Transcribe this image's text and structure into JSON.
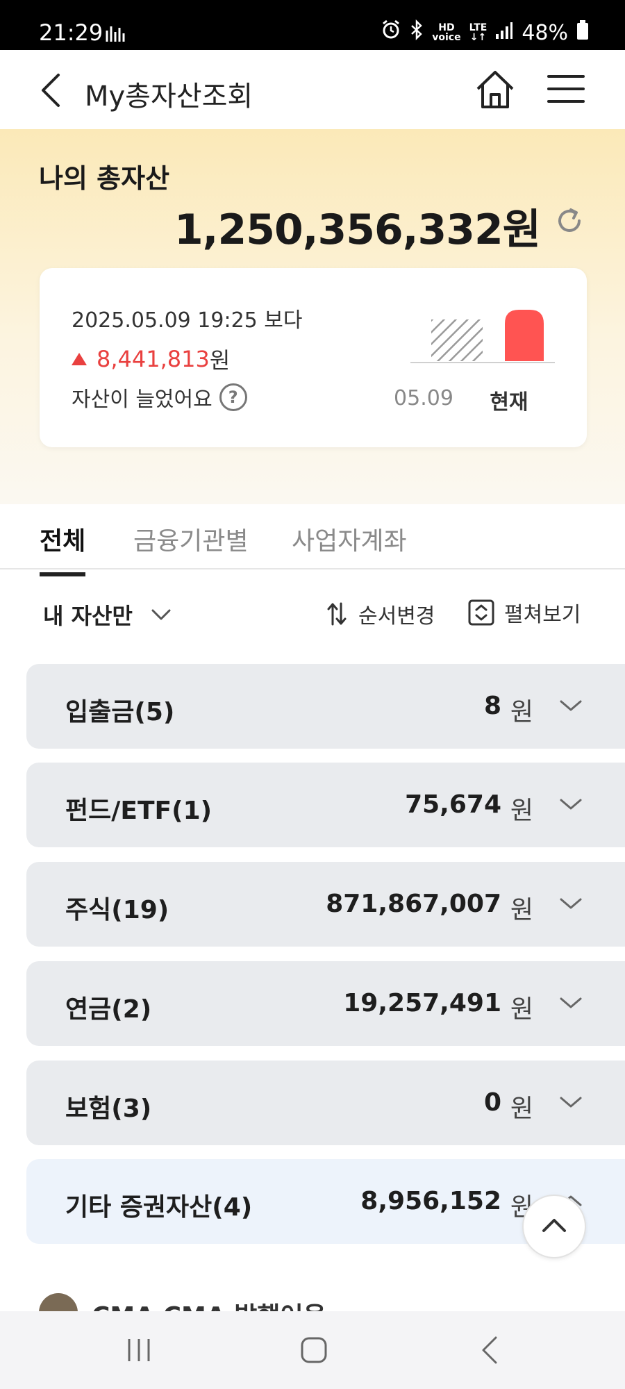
{
  "status_bar": {
    "time": "21:29",
    "battery": "48%",
    "network": "LTE",
    "voice": "HD",
    "icons": [
      "gallery-icon",
      "alarm-icon",
      "bluetooth-icon",
      "hd-voice-icon",
      "lte-icon",
      "signal-icon",
      "battery-icon"
    ]
  },
  "header": {
    "title": "My총자산조회",
    "icons": [
      "back-arrow-icon",
      "home-icon",
      "menu-icon"
    ]
  },
  "summary": {
    "label": "나의 총자산",
    "total": "1,250,356,332원",
    "compare": {
      "date_text": "2025.05.09 19:25 보다",
      "delta_value": "8,441,813",
      "delta_unit": "원",
      "message": "자산이 늘었어요",
      "help": "?",
      "bar_prev_label": "05.09",
      "bar_now_label": "현재",
      "colors": {
        "increase": "#e9403f",
        "now_bar": "#ff5452",
        "prev_bar_hatch": "#9a9a9a"
      }
    }
  },
  "tabs": [
    {
      "label": "전체",
      "active": true
    },
    {
      "label": "금융기관별",
      "active": false
    },
    {
      "label": "사업자계좌",
      "active": false
    }
  ],
  "filters": {
    "dropdown_label": "내 자산만",
    "sort_label": "순서변경",
    "expand_label": "펼쳐보기"
  },
  "assets": [
    {
      "name": "입출금(5)",
      "amount": "8",
      "unit": "원",
      "expanded": false
    },
    {
      "name": "펀드/ETF(1)",
      "amount": "75,674",
      "unit": "원",
      "expanded": false
    },
    {
      "name": "주식(19)",
      "amount": "871,867,007",
      "unit": "원",
      "expanded": false
    },
    {
      "name": "연금(2)",
      "amount": "19,257,491",
      "unit": "원",
      "expanded": false
    },
    {
      "name": "보험(3)",
      "amount": "0",
      "unit": "원",
      "expanded": false
    },
    {
      "name": "기타 증권자산(4)",
      "amount": "8,956,152",
      "unit": "원",
      "expanded": true
    }
  ],
  "partial_item": {
    "text": "CMA    CMA 발행어음"
  }
}
